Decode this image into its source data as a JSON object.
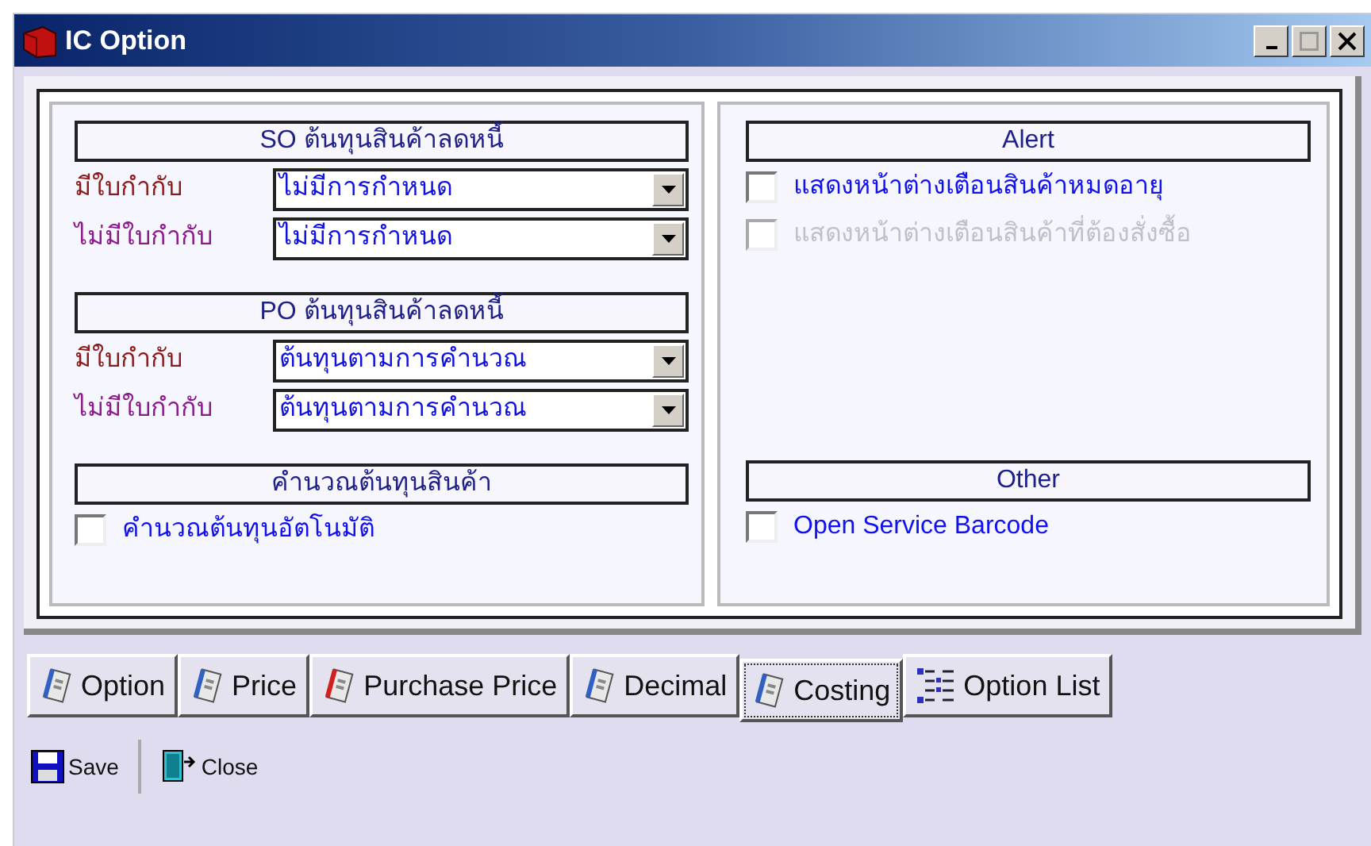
{
  "window": {
    "title": "IC Option"
  },
  "left_sections": [
    {
      "header": "SO ต้นทุนสินค้าลดหนี้",
      "rows": [
        {
          "kind": "select",
          "label": "มีใบกำกับ",
          "color": "#8b1a1a",
          "value": "ไม่มีการกำหนด"
        },
        {
          "kind": "select",
          "label": "ไม่มีใบกำกับ",
          "color": "#8b1a8b",
          "value": "ไม่มีการกำหนด"
        }
      ]
    },
    {
      "header": "PO ต้นทุนสินค้าลดหนี้",
      "rows": [
        {
          "kind": "select",
          "label": "มีใบกำกับ",
          "color": "#8b1a1a",
          "value": "ต้นทุนตามการคำนวณ"
        },
        {
          "kind": "select",
          "label": "ไม่มีใบกำกับ",
          "color": "#8b1a8b",
          "value": "ต้นทุนตามการคำนวณ"
        }
      ]
    },
    {
      "header": "คำนวณต้นทุนสินค้า",
      "rows": [
        {
          "kind": "checkbox",
          "label": "คำนวณต้นทุนอัตโนมัติ",
          "checked": false,
          "disabled": false
        }
      ]
    }
  ],
  "right_sections": [
    {
      "header": "Alert",
      "rows": [
        {
          "kind": "checkbox",
          "label": "แสดงหน้าต่างเตือนสินค้าหมดอายุ",
          "checked": false,
          "disabled": false
        },
        {
          "kind": "checkbox",
          "label": "แสดงหน้าต่างเตือนสินค้าที่ต้องสั่งซื้อ",
          "checked": false,
          "disabled": true
        }
      ]
    },
    {
      "header": "Other",
      "rows": [
        {
          "kind": "checkbox",
          "label": "Open Service Barcode",
          "checked": false,
          "disabled": false
        }
      ]
    }
  ],
  "tabs": [
    {
      "label": "Option",
      "kind": "book",
      "selected": false
    },
    {
      "label": "Price",
      "kind": "book",
      "selected": false
    },
    {
      "label": "Purchase Price",
      "kind": "bookred",
      "selected": false
    },
    {
      "label": "Decimal",
      "kind": "book",
      "selected": false
    },
    {
      "label": "Costing",
      "kind": "book",
      "selected": true
    },
    {
      "label": "Option List",
      "kind": "list",
      "selected": false
    }
  ],
  "toolbar": [
    {
      "label": "Save",
      "kind": "save"
    },
    {
      "label": "Close",
      "kind": "exit"
    }
  ]
}
